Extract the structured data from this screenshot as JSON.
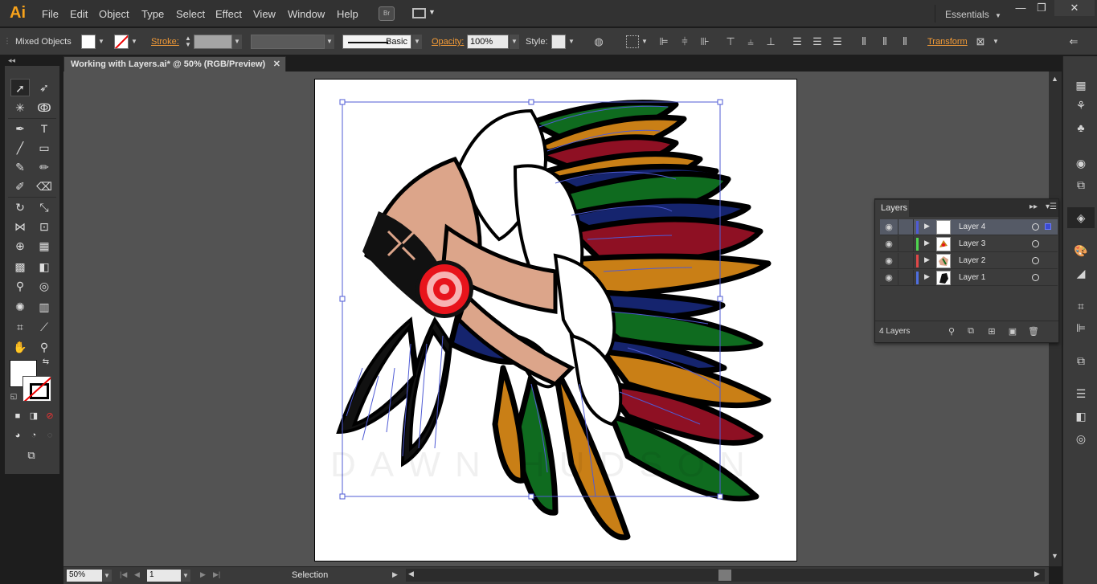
{
  "app": {
    "logo": "Ai",
    "menus": [
      "File",
      "Edit",
      "Object",
      "Type",
      "Select",
      "Effect",
      "View",
      "Window",
      "Help"
    ],
    "bridge_label": "Br",
    "workspace": "Essentials",
    "window_controls": {
      "minimize": "—",
      "restore": "❐",
      "close": "✕"
    }
  },
  "control_bar": {
    "selection_type": "Mixed Objects",
    "stroke_label": "Stroke:",
    "brush_label": "Basic",
    "opacity_label": "Opacity:",
    "opacity_value": "100%",
    "style_label": "Style:",
    "transform_label": "Transform"
  },
  "document": {
    "tab_title": "Working with Layers.ai* @ 50% (RGB/Preview)",
    "close": "✕"
  },
  "status_bar": {
    "zoom": "50%",
    "artboard": "1",
    "tool": "Selection"
  },
  "layers_panel": {
    "title": "Layers",
    "count_label": "4 Layers",
    "layers": [
      {
        "name": "Layer 4",
        "color": "#4f5bd5",
        "selected": true
      },
      {
        "name": "Layer 3",
        "color": "#4fd54f",
        "selected": false
      },
      {
        "name": "Layer 2",
        "color": "#e04848",
        "selected": false
      },
      {
        "name": "Layer 1",
        "color": "#4f6fe0",
        "selected": false
      }
    ]
  },
  "artwork": {
    "watermark": "DAWN HUDSON",
    "feather_colors": [
      "#0f6b1f",
      "#c97f16",
      "#8e1023",
      "#15246e"
    ]
  }
}
